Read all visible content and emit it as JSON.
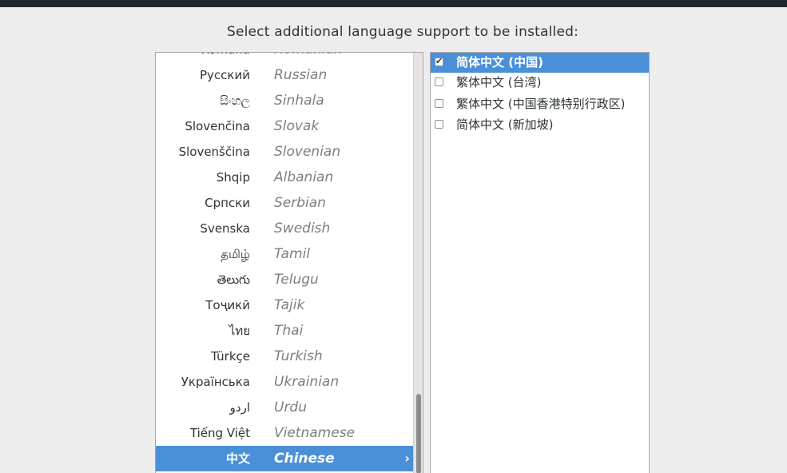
{
  "prompt": "Select additional language support to be installed:",
  "languages": [
    {
      "native": "Română",
      "english": "Romanian"
    },
    {
      "native": "Русский",
      "english": "Russian"
    },
    {
      "native": "සිංහල",
      "english": "Sinhala"
    },
    {
      "native": "Slovenčina",
      "english": "Slovak"
    },
    {
      "native": "Slovenščina",
      "english": "Slovenian"
    },
    {
      "native": "Shqip",
      "english": "Albanian"
    },
    {
      "native": "Српски",
      "english": "Serbian"
    },
    {
      "native": "Svenska",
      "english": "Swedish"
    },
    {
      "native": "தமிழ்",
      "english": "Tamil"
    },
    {
      "native": "తెలుగు",
      "english": "Telugu"
    },
    {
      "native": "Тоҷикӣ",
      "english": "Tajik"
    },
    {
      "native": "ไทย",
      "english": "Thai"
    },
    {
      "native": "Türkçe",
      "english": "Turkish"
    },
    {
      "native": "Українська",
      "english": "Ukrainian"
    },
    {
      "native": "اردو",
      "english": "Urdu"
    },
    {
      "native": "Tiếng Việt",
      "english": "Vietnamese"
    },
    {
      "native": "中文",
      "english": "Chinese",
      "selected": true
    }
  ],
  "selected_arrow": "›",
  "locales": [
    {
      "label": "简体中文 (中国)",
      "checked": true,
      "selected": true
    },
    {
      "label": "繁体中文 (台湾)",
      "checked": false
    },
    {
      "label": "繁体中文 (中国香港特别行政区)",
      "checked": false
    },
    {
      "label": "简体中文 (新加坡)",
      "checked": false
    }
  ],
  "check_glyph": "✔",
  "colors": {
    "selection": "#4a90d9",
    "topbar": "#20272c",
    "background": "#ededed"
  }
}
